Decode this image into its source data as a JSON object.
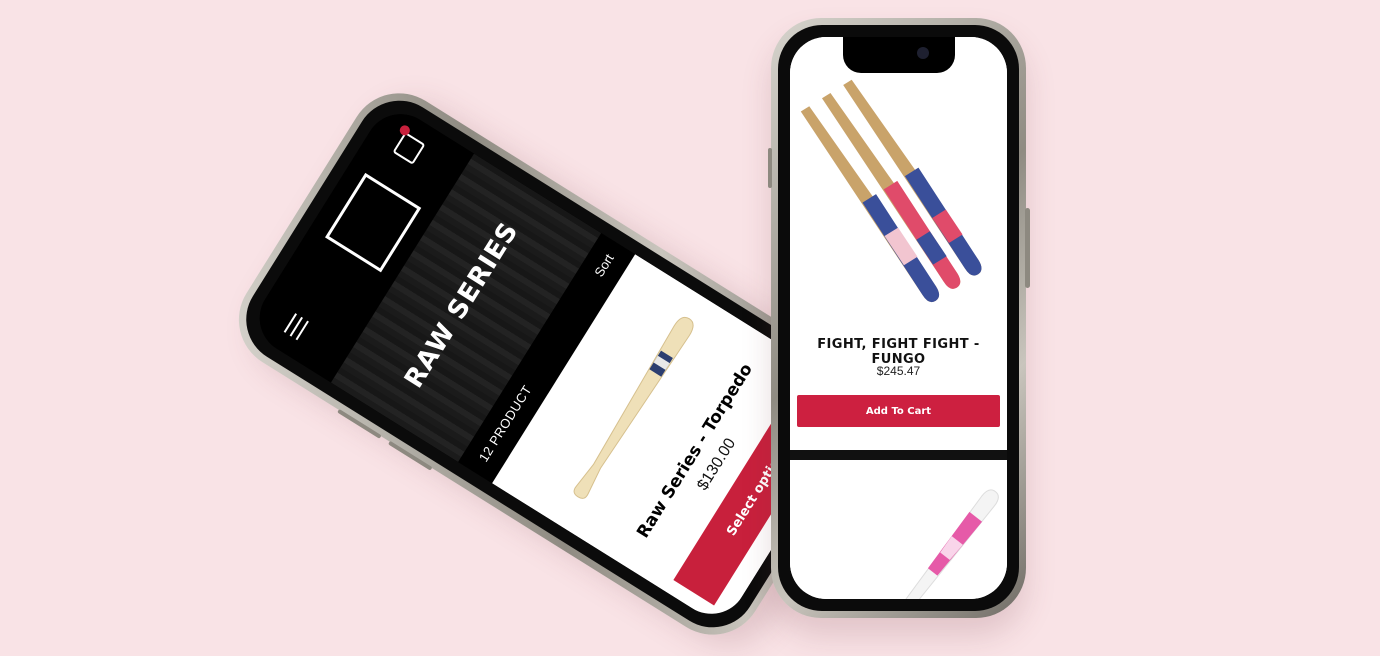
{
  "left_phone": {
    "banner_title": "RAW SERIES",
    "product_count": "12 PRODUCT",
    "sort_label": "Sort",
    "product": {
      "title": "Raw Series - Torpedo",
      "price": "$130.00",
      "button_label": "Select options"
    }
  },
  "right_phone": {
    "product": {
      "title": "FIGHT, FIGHT FIGHT - FUNGO",
      "price": "$245.47",
      "button_label": "Add To Cart"
    }
  },
  "colors": {
    "background": "#f9e3e6",
    "accent_red": "#c8203c",
    "header_black": "#000000"
  }
}
